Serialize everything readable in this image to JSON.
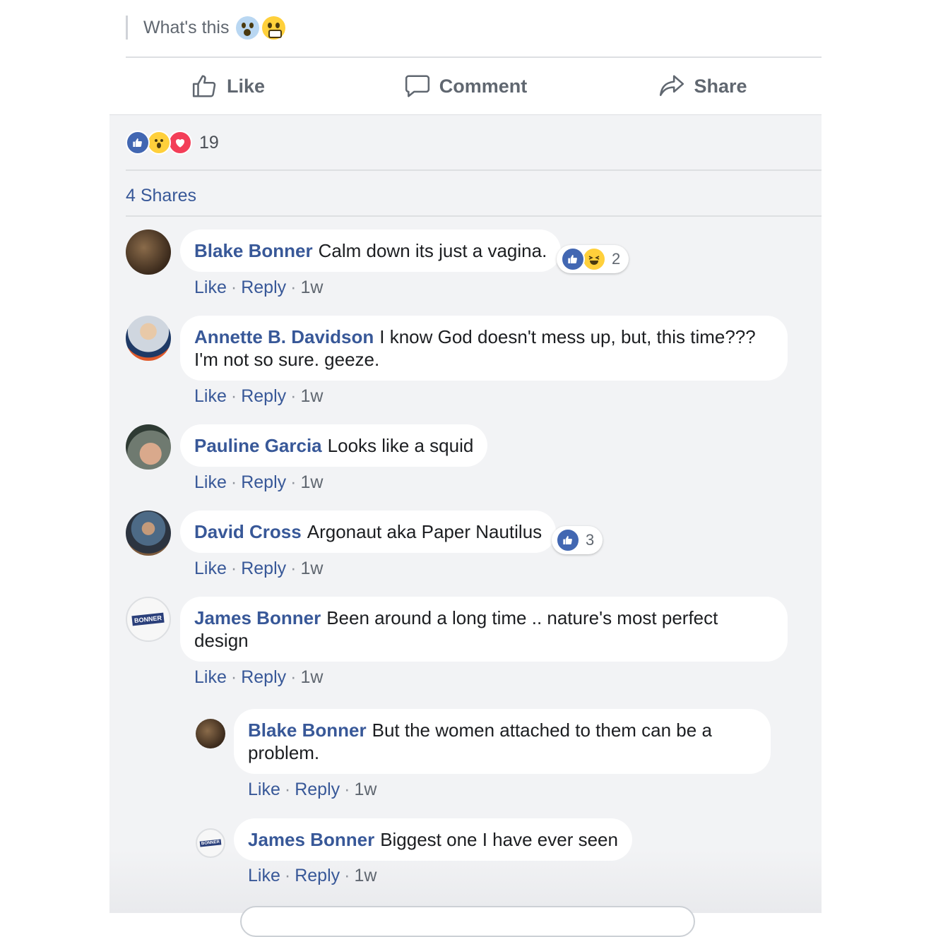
{
  "post": {
    "text": "What's this",
    "emojis": [
      "scream-emoji",
      "grimace-emoji"
    ]
  },
  "actions": {
    "like": "Like",
    "comment": "Comment",
    "share": "Share"
  },
  "reactions": {
    "count": "19",
    "types": [
      "like",
      "wow",
      "love"
    ]
  },
  "shares": "4 Shares",
  "comment_actions": {
    "like": "Like",
    "reply": "Reply",
    "sep": "·"
  },
  "comments": [
    {
      "name": "Blake Bonner",
      "text": "Calm down its just a vagina.",
      "time": "1w",
      "reaction_count": "2",
      "reactions": [
        "like",
        "haha"
      ]
    },
    {
      "name": "Annette B. Davidson",
      "text": "I know God doesn't mess up, but, this time??? I'm not so sure. geeze.",
      "time": "1w"
    },
    {
      "name": "Pauline Garcia",
      "text": "Looks like a squid",
      "time": "1w"
    },
    {
      "name": "David Cross",
      "text": "Argonaut aka Paper Nautilus",
      "time": "1w",
      "reaction_count": "3",
      "reactions": [
        "like"
      ]
    },
    {
      "name": "James Bonner",
      "text": "Been around a long time .. nature's most perfect design",
      "time": "1w"
    }
  ],
  "replies": [
    {
      "name": "Blake Bonner",
      "text": "But the women attached to them can be a problem.",
      "time": "1w"
    },
    {
      "name": "James Bonner",
      "text": "Biggest one I have ever seen",
      "time": "1w"
    }
  ],
  "avatar_badge": "BONNER",
  "colors": {
    "link": "#385898",
    "panel": "#f2f3f5",
    "like_blue": "#4267b2",
    "love_red": "#f33e58",
    "wow_yellow": "#ffd03b"
  }
}
